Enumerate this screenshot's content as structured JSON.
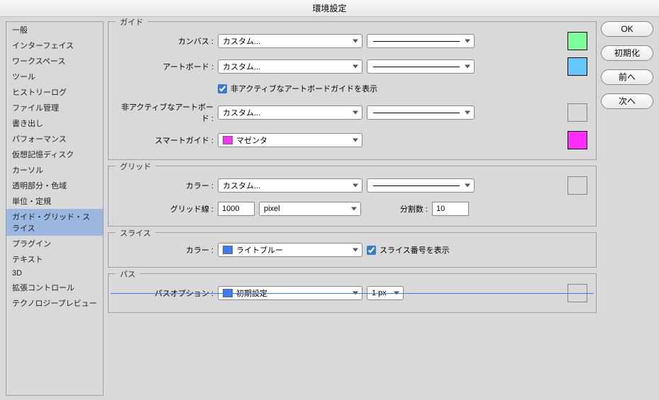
{
  "title": "環境設定",
  "buttons": {
    "ok": "OK",
    "reset": "初期化",
    "prev": "前へ",
    "next": "次へ"
  },
  "sidebar": {
    "items": [
      {
        "label": "一般"
      },
      {
        "label": "インターフェイス"
      },
      {
        "label": "ワークスペース"
      },
      {
        "label": "ツール"
      },
      {
        "label": "ヒストリーログ"
      },
      {
        "label": "ファイル管理"
      },
      {
        "label": "書き出し"
      },
      {
        "label": "パフォーマンス"
      },
      {
        "label": "仮想記憶ディスク"
      },
      {
        "label": "カーソル"
      },
      {
        "label": "透明部分・色域"
      },
      {
        "label": "単位・定規"
      },
      {
        "label": "ガイド・グリッド・スライス"
      },
      {
        "label": "プラグイン"
      },
      {
        "label": "テキスト"
      },
      {
        "label": "3D"
      },
      {
        "label": "拡張コントロール"
      },
      {
        "label": "テクノロジープレビュー"
      }
    ],
    "selected": 12
  },
  "guides": {
    "legend": "ガイド",
    "canvas_label": "カンバス :",
    "canvas_value": "カスタム...",
    "canvas_swatch": "#7dff9a",
    "artboard_label": "アートボード :",
    "artboard_value": "カスタム...",
    "artboard_swatch": "#64c8ff",
    "show_inactive_label": "非アクティブなアートボードガイドを表示",
    "inactive_label": "非アクティブなアートボード :",
    "inactive_value": "カスタム...",
    "inactive_swatch": "#d9d9d9",
    "smart_label": "スマートガイド :",
    "smart_value": "マゼンタ",
    "smart_chip": "#ff2eff",
    "smart_swatch": "#ff2eff"
  },
  "grid": {
    "legend": "グリッド",
    "color_label": "カラー :",
    "color_value": "カスタム...",
    "color_swatch": "#d9d9d9",
    "gridline_label": "グリッド線 :",
    "gridline_value": "1000",
    "gridline_unit": "pixel",
    "subdiv_label": "分割数 :",
    "subdiv_value": "10"
  },
  "slice": {
    "legend": "スライス",
    "color_label": "カラー :",
    "color_value": "ライトブルー",
    "color_chip": "#3a7cff",
    "show_label": "スライス番号を表示"
  },
  "path": {
    "legend": "パス",
    "option_label": "パスオプション :",
    "option_value": "初期設定",
    "option_chip": "#3a7cff",
    "width_value": "1 px",
    "swatch": "#d9d9d9"
  }
}
